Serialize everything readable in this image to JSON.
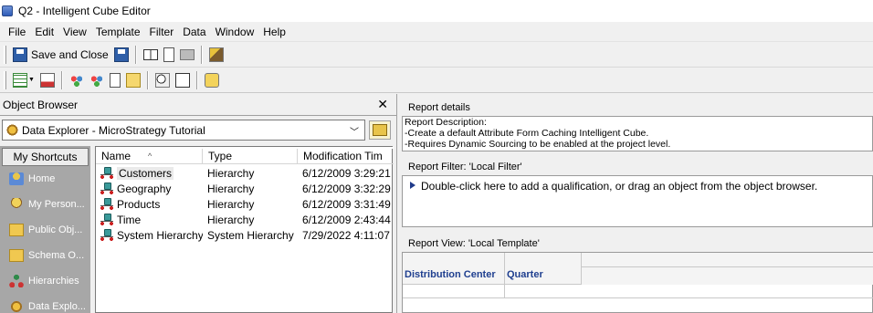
{
  "window": {
    "title": "Q2 - Intelligent Cube Editor"
  },
  "menu": [
    "File",
    "Edit",
    "View",
    "Template",
    "Filter",
    "Data",
    "Window",
    "Help"
  ],
  "toolbar": {
    "save_close_label": "Save and Close"
  },
  "object_browser": {
    "title": "Object Browser",
    "close_glyph": "✕",
    "explorer_value": "Data Explorer - MicroStrategy Tutorial",
    "shortcuts_header": "My Shortcuts",
    "shortcuts": [
      {
        "label": "Home",
        "icon": "home-icon"
      },
      {
        "label": "My Person...",
        "icon": "person-icon"
      },
      {
        "label": "Public Obj...",
        "icon": "folder-icon"
      },
      {
        "label": "Schema O...",
        "icon": "folder-icon"
      },
      {
        "label": "Hierarchies",
        "icon": "hierarchy-icon"
      },
      {
        "label": "Data Explo...",
        "icon": "explorer-icon"
      }
    ],
    "columns": [
      "Name",
      "Type",
      "Modification Tim"
    ],
    "rows": [
      {
        "name": "Customers",
        "type": "Hierarchy",
        "modified": "6/12/2009 3:29:21"
      },
      {
        "name": "Geography",
        "type": "Hierarchy",
        "modified": "6/12/2009 3:32:29"
      },
      {
        "name": "Products",
        "type": "Hierarchy",
        "modified": "6/12/2009 3:31:49"
      },
      {
        "name": "Time",
        "type": "Hierarchy",
        "modified": "6/12/2009 2:43:44"
      },
      {
        "name": "System Hierarchy",
        "type": "System Hierarchy",
        "modified": "7/29/2022 4:11:07"
      }
    ]
  },
  "report_details": {
    "label": "Report details",
    "description_lines": [
      "Report Description:",
      "-Create a default Attribute Form Caching Intelligent Cube.",
      "-Requires Dynamic Sourcing to be enabled at the project level."
    ]
  },
  "report_filter": {
    "label": "Report Filter: 'Local Filter'",
    "hint": "Double-click here to add a qualification, or drag an object from the object browser."
  },
  "report_view": {
    "label": "Report View: 'Local Template'",
    "headers": [
      "Distribution Center",
      "Quarter"
    ]
  },
  "colors": {
    "header_blue": "#1f3f8f",
    "shortcuts_bg": "#a7a7a7"
  }
}
